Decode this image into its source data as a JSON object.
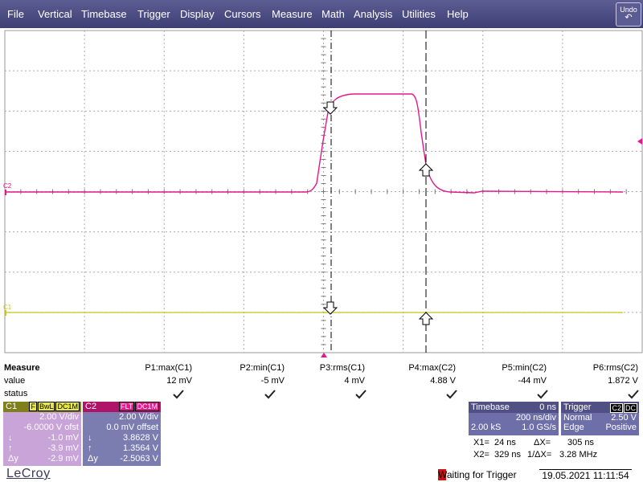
{
  "menu": [
    "File",
    "Vertical",
    "Timebase",
    "Trigger",
    "Display",
    "Cursors",
    "Measure",
    "Math",
    "Analysis",
    "Utilities",
    "Help"
  ],
  "undo_label": "Undo",
  "grid": {
    "trace_labels": {
      "c2": "C2",
      "c1": "C1"
    },
    "colors": {
      "c1": "#c7c716",
      "c2": "#e6168c",
      "trigger": "#e6168c"
    }
  },
  "measure": {
    "row_labels": [
      "Measure",
      "value",
      "status"
    ],
    "columns": [
      {
        "param": "P1:max(C1)",
        "value": "12 mV"
      },
      {
        "param": "P2:min(C1)",
        "value": "-5 mV"
      },
      {
        "param": "P3:rms(C1)",
        "value": "4 mV"
      },
      {
        "param": "P4:max(C2)",
        "value": "4.88 V"
      },
      {
        "param": "P5:min(C2)",
        "value": "-44 mV"
      },
      {
        "param": "P6:rms(C2)",
        "value": "1.872 V"
      }
    ]
  },
  "channels": {
    "c1": {
      "name": "C1",
      "tags": [
        "F",
        "BwL",
        "DC1M"
      ],
      "vdiv": "2.00 V/div",
      "offset": "-6.0000 V ofst",
      "rows": [
        {
          "label": "↓",
          "value": "-1.0 mV"
        },
        {
          "label": "↑",
          "value": "-3.9 mV"
        },
        {
          "label": "Δy",
          "value": "-2.9 mV"
        }
      ]
    },
    "c2": {
      "name": "C2",
      "tags": [
        "FLT",
        "DC1M"
      ],
      "vdiv": "2.00 V/div",
      "offset": "0.0 mV offset",
      "rows": [
        {
          "label": "↓",
          "value": "3.8628 V"
        },
        {
          "label": "↑",
          "value": "1.3564 V"
        },
        {
          "label": "Δy",
          "value": "-2.5063 V"
        }
      ]
    }
  },
  "timebase": {
    "title": "Timebase",
    "delay": "0 ns",
    "tdiv": "200 ns/div",
    "samples": "2.00 kS",
    "rate": "1.0 GS/s"
  },
  "trigger": {
    "title": "Trigger",
    "source_tag": "C2",
    "coupling_tag": "DC",
    "mode": "Normal",
    "level": "2.50 V",
    "type": "Edge",
    "slope": "Positive"
  },
  "cursors": {
    "x1": "X1=",
    "x1_val": "24 ns",
    "dx": "ΔX=",
    "dx_val": "305 ns",
    "x2": "X2=",
    "x2_val": "329 ns",
    "inv": "1/ΔX=",
    "inv_val": "3.28 MHz"
  },
  "status": "Waiting for Trigger",
  "datetime": "19.05.2021 11:11:54",
  "logo": "LeCroy"
}
